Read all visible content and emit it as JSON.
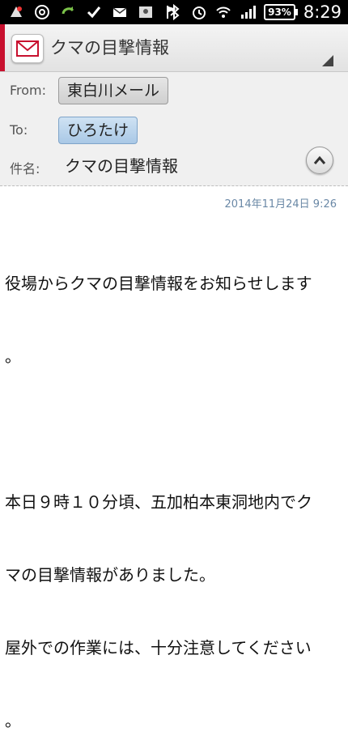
{
  "status_bar": {
    "battery": "93%",
    "time": "8:29"
  },
  "app": {
    "title": "クマの目撃情報"
  },
  "header": {
    "from_label": "From:",
    "from_value": "東白川メール",
    "to_label": "To:",
    "to_value": "ひろたけ",
    "subject_label": "件名:",
    "subject_value": "クマの目撃情報"
  },
  "message": {
    "date": "2014年11月24日 9:26",
    "lines": [
      "役場からクマの目撃情報をお知らせします",
      "。",
      "",
      "本日９時１０分頃、五加柏本東洞地内でク",
      "マの目撃情報がありました。",
      "屋外での作業には、十分注意してください",
      "。"
    ]
  },
  "colors": {
    "accent": "#c8102e",
    "to_chip": "#a9c8e6",
    "date_text": "#6a88a6"
  }
}
